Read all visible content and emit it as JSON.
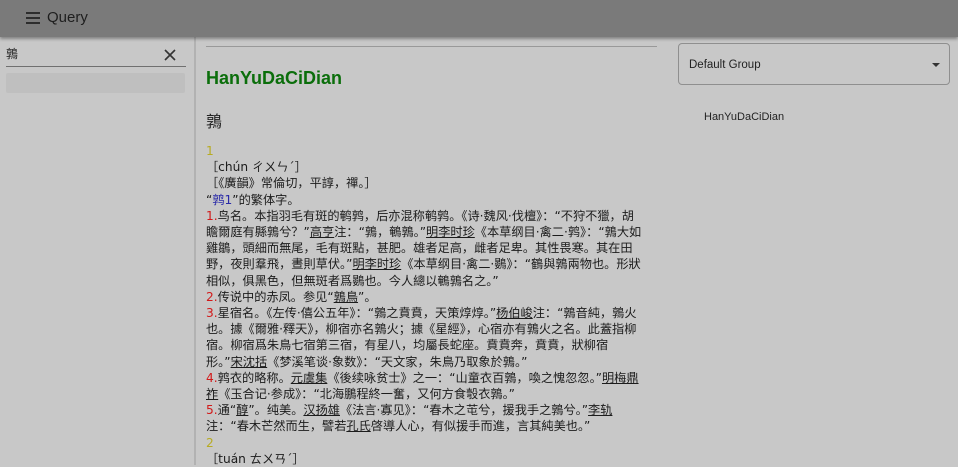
{
  "app": {
    "title": "Query"
  },
  "search": {
    "value": "鶉",
    "placeholder": ""
  },
  "main": {
    "dictionary_title": "HanYuDaCiDian",
    "headword": "鶉",
    "entry_lines": [
      [
        {
          "t": "1",
          "c": "num-y"
        }
      ],
      [
        {
          "t": "［chún ㄔㄨㄣˊ］"
        }
      ],
      [
        {
          "t": "［《廣韻》常倫切，平諄，禪。］"
        }
      ],
      [
        {
          "t": "“"
        },
        {
          "t": "鹑1",
          "c": "blue"
        },
        {
          "t": "”的繁体字。"
        }
      ],
      [
        {
          "t": "1.",
          "c": "num-r"
        },
        {
          "t": "鸟名。本指羽毛有斑的鹌鹑，后亦混称鹌鹑。《诗·魏风·伐檀》：“不狩不獵，胡"
        }
      ],
      [
        {
          "t": "瞻爾庭有縣鶉兮？”"
        },
        {
          "t": "高亨",
          "c": "u"
        },
        {
          "t": "注：“鶉，鵪鶉。”"
        },
        {
          "t": "明李时珍",
          "c": "u"
        },
        {
          "t": "《本草纲目·禽二·鹑》：“鶉大如"
        }
      ],
      [
        {
          "t": "雞鶵，頭細而無尾，毛有斑點，甚肥。雄者足高，雌者足卑。其性畏寒。其在田"
        }
      ],
      [
        {
          "t": "野，夜則羣飛，晝則草伏。”"
        },
        {
          "t": "明李时珍",
          "c": "u"
        },
        {
          "t": "《本草纲目·禽二·鷃》：“鶴與鶉兩物也。形狀"
        }
      ],
      [
        {
          "t": "相似，俱黑色，但無斑者爲鷃也。今人總以鵪鶉名之。”"
        }
      ],
      [
        {
          "t": "2.",
          "c": "num-r"
        },
        {
          "t": "传说中的赤凤。参见“"
        },
        {
          "t": "鶉鳥",
          "c": "u"
        },
        {
          "t": "”。"
        }
      ],
      [
        {
          "t": "3.",
          "c": "num-r"
        },
        {
          "t": "星宿名。《左传·僖公五年》：“鶉之賁賁，天策焞焞。”"
        },
        {
          "t": "杨伯峻",
          "c": "u"
        },
        {
          "t": "注：“鶉音純，鶉火"
        }
      ],
      [
        {
          "t": "也。據《爾雅·釋天》，柳宿亦名鶉火；據《星經》，心宿亦有鶉火之名。此蓋指柳"
        }
      ],
      [
        {
          "t": "宿。柳宿爲朱鳥七宿第三宿，有星八，均屬長蛇座。賁賁奔，賁賁，狀柳宿"
        }
      ],
      [
        {
          "t": "形。”"
        },
        {
          "t": "宋沈括",
          "c": "u"
        },
        {
          "t": "《梦溪笔谈·象数》：“天文家，朱鳥乃取象於鶉。”"
        }
      ],
      [
        {
          "t": "4.",
          "c": "num-r"
        },
        {
          "t": "鹑衣的略称。"
        },
        {
          "t": "元虞集",
          "c": "u"
        },
        {
          "t": "《後续咏贫士》之一：“山童衣百鶉，喚之愧忽忽。”"
        },
        {
          "t": "明梅鼎",
          "c": "u"
        }
      ],
      [
        {
          "t": "祚",
          "c": "u"
        },
        {
          "t": "《玉合记·参成》：“北海鵬程終一奮，又何方食彀衣鶉。”"
        }
      ],
      [
        {
          "t": "5.",
          "c": "num-r"
        },
        {
          "t": "通“"
        },
        {
          "t": "醇",
          "c": "u"
        },
        {
          "t": "”。纯美。"
        },
        {
          "t": "汉扬雄",
          "c": "u"
        },
        {
          "t": "《法言·寡见》：“春木之芚兮，援我手之鶉兮。”"
        },
        {
          "t": "李轨",
          "c": "u"
        }
      ],
      [
        {
          "t": "注：“春木芒然而生，譬若"
        },
        {
          "t": "孔氏",
          "c": "u"
        },
        {
          "t": "啓導人心，有似援手而進，言其純美也。”"
        }
      ],
      [
        {
          "t": "2",
          "c": "num-y"
        }
      ],
      [
        {
          "t": "［tuán ㄊㄨㄢˊ］"
        }
      ]
    ]
  },
  "right": {
    "group_select": "Default Group",
    "dictionaries": [
      "HanYuDaCiDian"
    ]
  },
  "icons": {
    "menu": "menu-icon",
    "clear": "close-icon",
    "dropdown": "caret-down-icon"
  }
}
